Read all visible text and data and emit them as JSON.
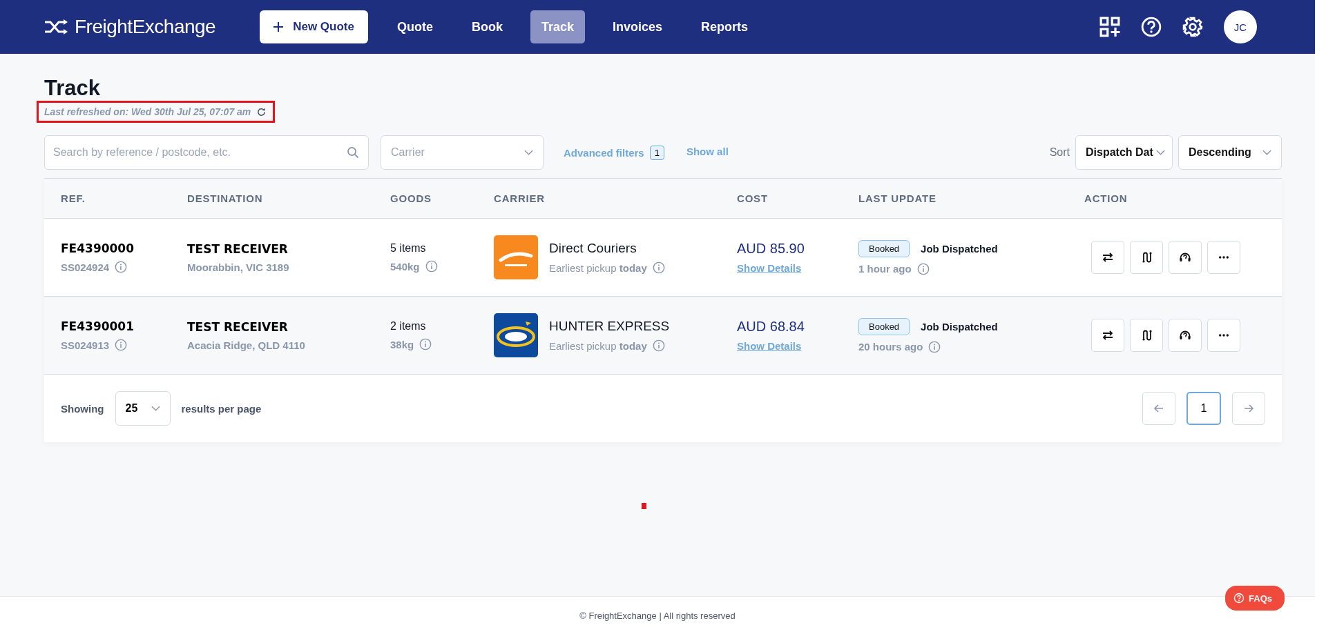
{
  "header": {
    "logo": "FreightExchange",
    "new_quote": "New Quote",
    "nav": [
      {
        "label": "Quote",
        "selected": false
      },
      {
        "label": "Book",
        "selected": false
      },
      {
        "label": "Track",
        "selected": true
      },
      {
        "label": "Invoices",
        "selected": false
      },
      {
        "label": "Reports",
        "selected": false
      }
    ],
    "avatar": "JC"
  },
  "page": {
    "title": "Track",
    "last_refreshed": "Last refreshed on: Wed 30th Jul 25, 07:07 am"
  },
  "filters": {
    "search": {
      "placeholder": "Search by reference / postcode, etc."
    },
    "carrier": {
      "placeholder": "Carrier"
    },
    "advanced_filters": "Advanced filters",
    "advanced_count": "1",
    "show_all": "Show all",
    "sort_label": "Sort",
    "sort_field": "Dispatch Dat",
    "sort_order": "Descending"
  },
  "table": {
    "columns": [
      "REF.",
      "DESTINATION",
      "GOODS",
      "CARRIER",
      "COST",
      "LAST UPDATE",
      "ACTION"
    ],
    "rows": [
      {
        "ref": "FE4390000",
        "sub_ref": "SS024924",
        "destination": "TEST RECEIVER",
        "place": "Moorabbin, VIC 3189",
        "goods": "5 items",
        "weight": "540kg",
        "carrier": {
          "name": "Direct Couriers",
          "kind": "direct"
        },
        "pickup": "Earliest pickup **today**",
        "cost": "AUD 85.90",
        "details": "Show Details",
        "status": "Booked",
        "event": "Job Dispatched",
        "time": "1 hour ago"
      },
      {
        "ref": "FE4390001",
        "sub_ref": "SS024913",
        "destination": "TEST RECEIVER",
        "place": "Acacia Ridge, QLD 4110",
        "goods": "2 items",
        "weight": "38kg",
        "carrier": {
          "name": "HUNTER EXPRESS",
          "kind": "hunter"
        },
        "pickup": "Earliest pickup **today**",
        "cost": "AUD 68.84",
        "details": "Show Details",
        "status": "Booked",
        "event": "Job Dispatched",
        "time": "20 hours ago"
      }
    ]
  },
  "pagination": {
    "showing": "Showing",
    "per_page": "25",
    "results_per_page": "results per page",
    "pages": [
      {
        "label": "1",
        "selected": true
      }
    ]
  },
  "footer": {
    "text": "© FreightExchange | All rights reserved",
    "faqs": "FAQs"
  }
}
